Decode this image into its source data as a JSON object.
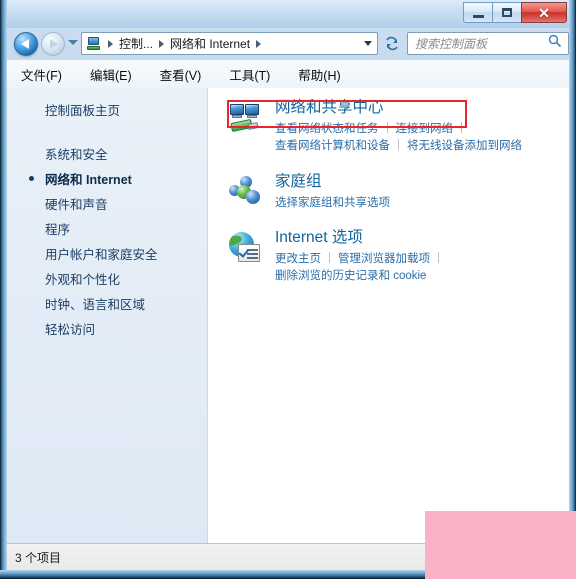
{
  "window": {
    "caption_buttons": [
      {
        "name": "minimize",
        "glyph": "—"
      },
      {
        "name": "maximize",
        "glyph": "❐"
      },
      {
        "name": "close",
        "glyph": "✕"
      }
    ]
  },
  "navbar": {
    "back_tooltip": "后退",
    "forward_tooltip": "前进",
    "breadcrumbs": [
      "控制...",
      "网络和 Internet"
    ],
    "address_dropdown": "▼",
    "refresh": "刷新",
    "search_placeholder": "搜索控制面板"
  },
  "menubar": {
    "items": [
      "文件(F)",
      "编辑(E)",
      "查看(V)",
      "工具(T)",
      "帮助(H)"
    ]
  },
  "sidebar": {
    "home": "控制面板主页",
    "items": [
      {
        "label": "系统和安全",
        "current": false
      },
      {
        "label": "网络和 Internet",
        "current": true
      },
      {
        "label": "硬件和声音",
        "current": false
      },
      {
        "label": "程序",
        "current": false
      },
      {
        "label": "用户帐户和家庭安全",
        "current": false
      },
      {
        "label": "外观和个性化",
        "current": false
      },
      {
        "label": "时钟、语言和区域",
        "current": false
      },
      {
        "label": "轻松访问",
        "current": false
      }
    ]
  },
  "main": {
    "categories": [
      {
        "icon": "network-sharing-center-icon",
        "title": "网络和共享中心",
        "title_suffix": "",
        "highlighted": true,
        "link_rows": [
          [
            "查看网络状态和任务",
            "连接到网络"
          ],
          [
            "查看网络计算机和设备",
            "将无线设备添加到网络"
          ]
        ]
      },
      {
        "icon": "homegroup-icon",
        "title": "家庭组",
        "title_suffix": "",
        "highlighted": false,
        "link_rows": [
          [
            "选择家庭组和共享选项"
          ]
        ]
      },
      {
        "icon": "internet-options-icon",
        "title": "Internet",
        "title_suffix": " 选项",
        "highlighted": false,
        "link_rows": [
          [
            "更改主页",
            "管理浏览器加载项"
          ],
          [
            "删除浏览的历史记录和 cookie"
          ]
        ]
      }
    ]
  },
  "statusbar": {
    "item_count_text": "3 个项目"
  },
  "colors": {
    "highlight_box": "#e8252a",
    "link": "#2a6ea8",
    "category_title": "#12639e",
    "sidebar_text": "#1b3e66",
    "pink_overlay": "#fcb2c6"
  }
}
